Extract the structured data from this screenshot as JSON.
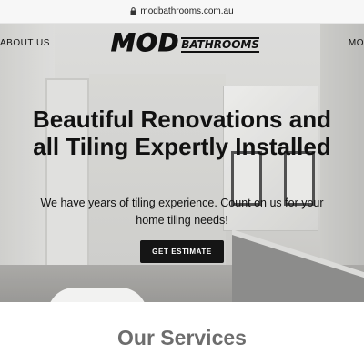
{
  "browser": {
    "url": "modbathrooms.com.au"
  },
  "nav": {
    "left_item": "ABOUT US",
    "right_item": "MO"
  },
  "logo": {
    "main": "MOD",
    "sub": "BATHROOMS"
  },
  "hero": {
    "headline": "Beautiful Renovations and all Tiling Expertly Installed",
    "subtext": "We have years of tiling experience. Count on us for your home tiling needs!",
    "cta_label": "GET ESTIMATE"
  },
  "services": {
    "heading": "Our Services"
  },
  "colors": {
    "cta_background": "#151515",
    "services_heading": "#6d6d6d"
  },
  "icons": [
    "lock-icon"
  ]
}
